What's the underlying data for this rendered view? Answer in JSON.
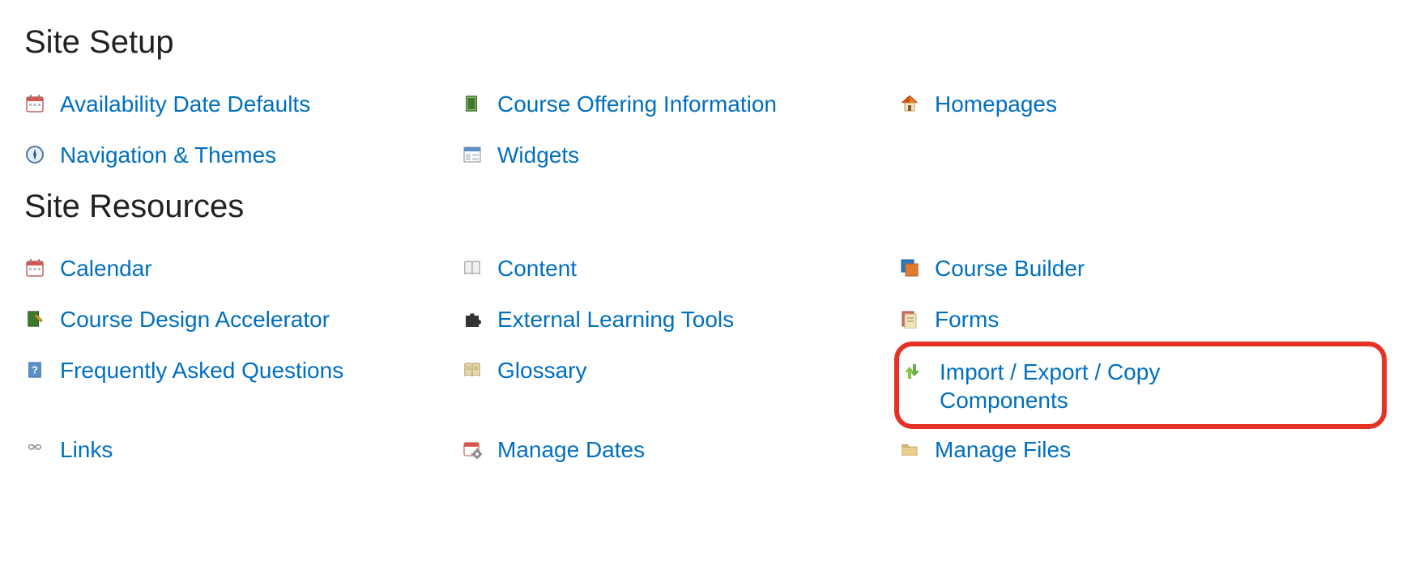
{
  "sections": [
    {
      "id": "site-setup",
      "heading": "Site Setup",
      "rows": [
        [
          {
            "icon": "calendar-icon",
            "label": "Availability Date Defaults",
            "name": "availability-date-defaults"
          },
          {
            "icon": "book-icon",
            "label": "Course Offering Information",
            "name": "course-offering-information"
          },
          {
            "icon": "home-icon",
            "label": "Homepages",
            "name": "homepages"
          }
        ],
        [
          {
            "icon": "compass-icon",
            "label": "Navigation & Themes",
            "name": "navigation-themes"
          },
          {
            "icon": "widget-icon",
            "label": "Widgets",
            "name": "widgets"
          },
          null
        ]
      ]
    },
    {
      "id": "site-resources",
      "heading": "Site Resources",
      "rows": [
        [
          {
            "icon": "calendar-icon",
            "label": "Calendar",
            "name": "calendar"
          },
          {
            "icon": "book-open-icon",
            "label": "Content",
            "name": "content"
          },
          {
            "icon": "stack-icon",
            "label": "Course Builder",
            "name": "course-builder"
          }
        ],
        [
          {
            "icon": "book-edit-icon",
            "label": "Course Design Accelerator",
            "name": "course-design-accelerator"
          },
          {
            "icon": "puzzle-icon",
            "label": "External Learning Tools",
            "name": "external-learning-tools"
          },
          {
            "icon": "forms-icon",
            "label": "Forms",
            "name": "forms"
          }
        ],
        [
          {
            "icon": "question-book-icon",
            "label": "Frequently Asked Questions",
            "name": "frequently-asked-questions"
          },
          {
            "icon": "glossary-icon",
            "label": "Glossary",
            "name": "glossary"
          },
          {
            "icon": "import-export-icon",
            "label": "Import / Export / Copy Components",
            "name": "import-export-copy-components",
            "highlighted": true
          }
        ],
        [
          {
            "icon": "chain-icon",
            "label": "Links",
            "name": "links"
          },
          {
            "icon": "calendar-gear-icon",
            "label": "Manage Dates",
            "name": "manage-dates"
          },
          {
            "icon": "folder-icon",
            "label": "Manage Files",
            "name": "manage-files"
          }
        ]
      ]
    }
  ]
}
